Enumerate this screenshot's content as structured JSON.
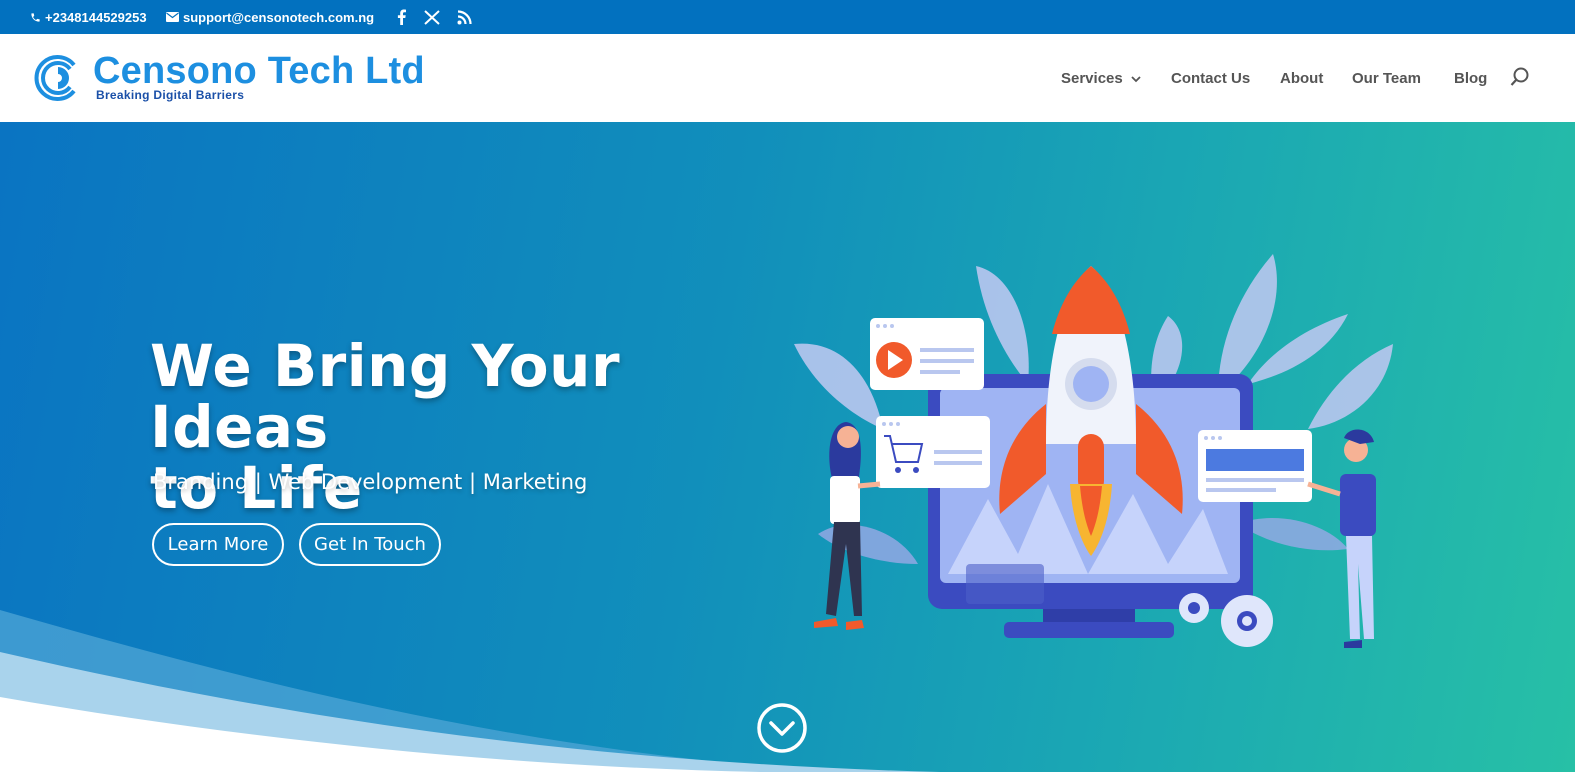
{
  "topbar": {
    "phone": "+2348144529253",
    "email": "support@censonotech.com.ng",
    "social": [
      "facebook-icon",
      "x-icon",
      "rss-icon"
    ]
  },
  "header": {
    "brand_name": "Censono Tech Ltd",
    "brand_tagline": "Breaking Digital Barriers",
    "nav": {
      "services": "Services",
      "contact": "Contact Us",
      "about": "About",
      "team": "Our Team",
      "blog": "Blog"
    }
  },
  "hero": {
    "title_line1": "We Bring Your Ideas",
    "title_line2": "to Life",
    "subtitle": "Branding | Web Development | Marketing",
    "learn_more": "Learn More",
    "get_in_touch": "Get In Touch"
  },
  "colors": {
    "topbar": "#0271bf",
    "brand_blue": "#1d8fe0",
    "hero_start": "#0a74c2",
    "hero_end": "#27c0a6",
    "rocket": "#f15a2b",
    "monitor": "#3b4bc0"
  }
}
